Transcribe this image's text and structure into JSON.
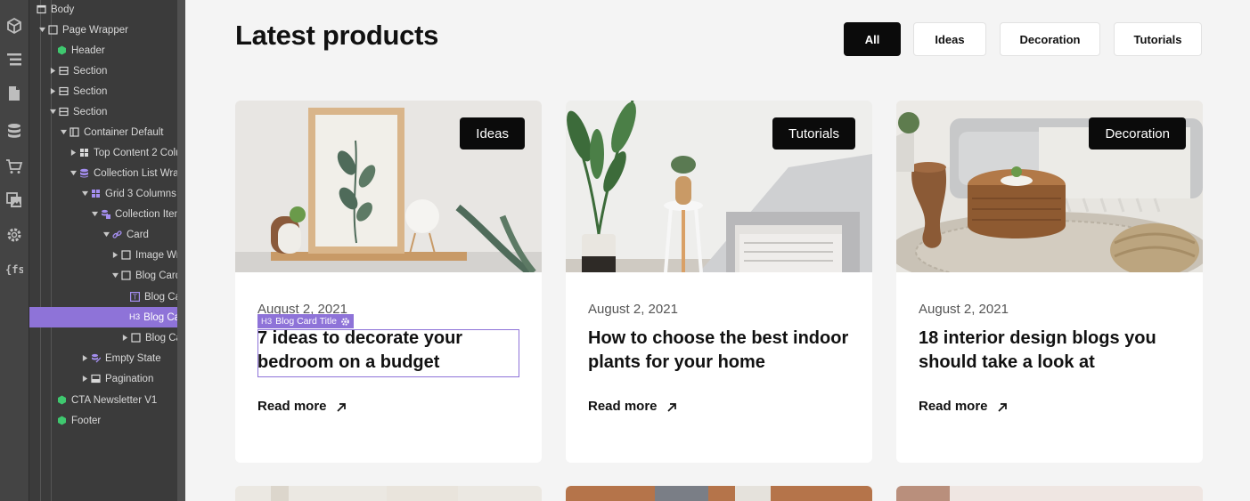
{
  "rail": {
    "icons": [
      "add-elements-icon",
      "navigator-icon",
      "pages-icon",
      "cms-icon",
      "ecommerce-icon",
      "assets-icon",
      "settings-icon",
      "finsweet-icon"
    ]
  },
  "navigator": {
    "items": [
      {
        "label": "Body",
        "icon": "body-icon"
      },
      {
        "label": "Page Wrapper",
        "icon": "div-block-icon"
      },
      {
        "label": "Header",
        "icon": "symbol-icon"
      },
      {
        "label": "Section",
        "icon": "section-icon"
      },
      {
        "label": "Section",
        "icon": "section-icon"
      },
      {
        "label": "Section",
        "icon": "section-icon"
      },
      {
        "label": "Container Default",
        "icon": "container-icon"
      },
      {
        "label": "Top Content 2 Colu",
        "icon": "grid-icon"
      },
      {
        "label": "Collection List Wrap",
        "icon": "collection-icon"
      },
      {
        "label": "Grid 3 Columns",
        "icon": "collection-grid-icon"
      },
      {
        "label": "Collection Item",
        "icon": "collection-item-icon"
      },
      {
        "label": "Card",
        "icon": "link-block-icon"
      },
      {
        "label": "Image Wra",
        "icon": "div-block-icon"
      },
      {
        "label": "Blog Card",
        "icon": "div-block-icon"
      },
      {
        "label": "Blog Ca",
        "icon": "text-block-icon"
      },
      {
        "label": "Blog Ca",
        "icon": "heading-icon",
        "icon_text": "H3"
      },
      {
        "label": "Blog Ca",
        "icon": "div-block-icon"
      },
      {
        "label": "Empty State",
        "icon": "empty-state-icon"
      },
      {
        "label": "Pagination",
        "icon": "pagination-icon"
      },
      {
        "label": "CTA Newsletter V1",
        "icon": "symbol-icon"
      },
      {
        "label": "Footer",
        "icon": "symbol-icon"
      }
    ]
  },
  "page": {
    "title": "Latest products",
    "filters": [
      "All",
      "Ideas",
      "Decoration",
      "Tutorials"
    ],
    "active_filter": "All"
  },
  "cards": [
    {
      "tag": "Ideas",
      "date": "August 2, 2021",
      "title": "7 ideas to decorate your bedroom on a budget",
      "read_more": "Read more"
    },
    {
      "tag": "Tutorials",
      "date": "August 2, 2021",
      "title": "How to choose the best indoor plants for your home",
      "read_more": "Read more"
    },
    {
      "tag": "Decoration",
      "date": "August 2, 2021",
      "title": "18 interior design blogs you should take a look at",
      "read_more": "Read more"
    }
  ],
  "selection": {
    "badge_prefix": "H3",
    "label": "Blog Card Title"
  },
  "colors": {
    "accent": "#8e73d8",
    "symbol": "#3fc86f",
    "panel": "#3b3b3b",
    "rail": "#444444",
    "tag_bg": "#0b0b0b",
    "canvas": "#f4f4f4"
  }
}
